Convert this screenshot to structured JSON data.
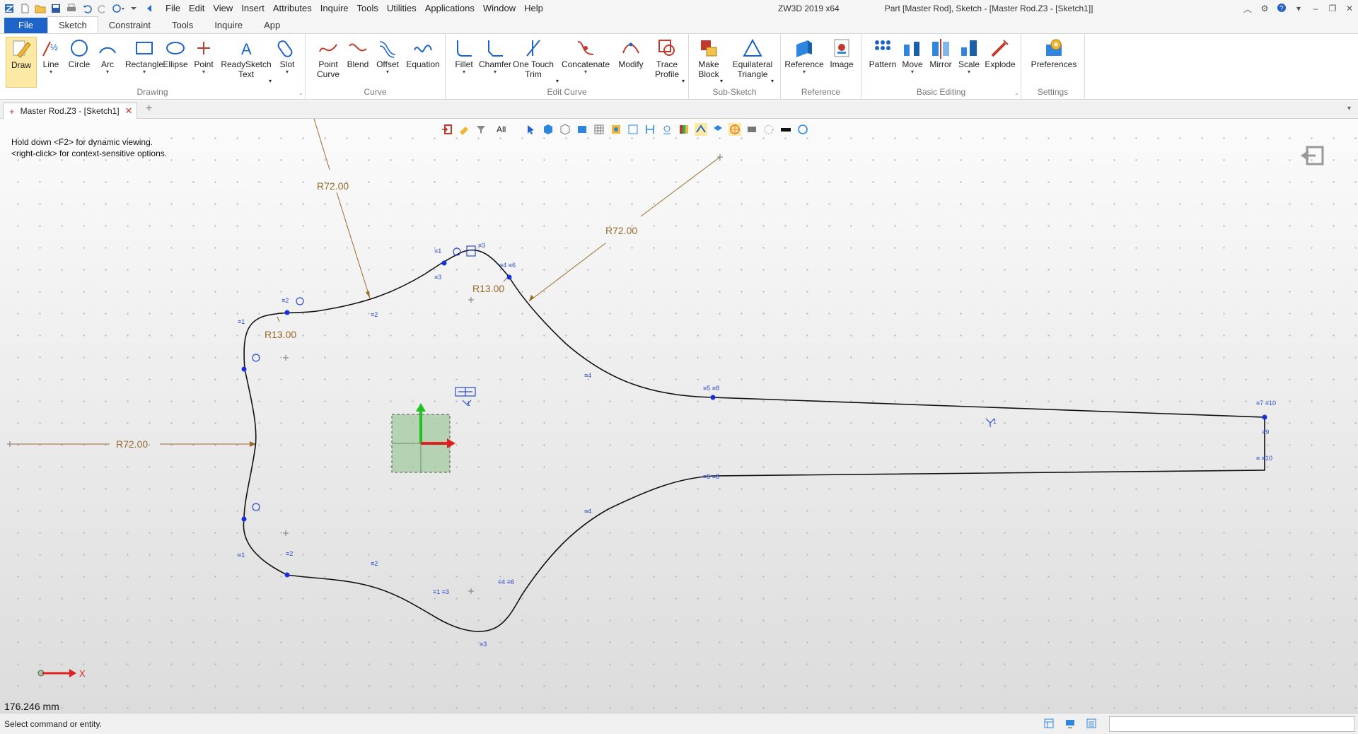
{
  "title": {
    "app": "ZW3D 2019  x64",
    "document": "Part [Master Rod],  Sketch - [Master Rod.Z3 - [Sketch1]]"
  },
  "menu": [
    "File",
    "Edit",
    "View",
    "Insert",
    "Attributes",
    "Inquire",
    "Tools",
    "Utilities",
    "Applications",
    "Window",
    "Help"
  ],
  "tabs": [
    "File",
    "Sketch",
    "Constraint",
    "Tools",
    "Inquire",
    "App"
  ],
  "ribbon": {
    "groups": {
      "drawing": "Drawing",
      "curve": "Curve",
      "edit_curve": "Edit Curve",
      "sub_sketch": "Sub-Sketch",
      "reference": "Reference",
      "basic_editing": "Basic Editing",
      "settings": "Settings"
    },
    "buttons": {
      "draw": "Draw",
      "line": "Line",
      "circle": "Circle",
      "arc": "Arc",
      "rectangle": "Rectangle",
      "ellipse": "Ellipse",
      "point": "Point",
      "readysketch_1": "ReadySketch",
      "readysketch_2": "Text",
      "slot": "Slot",
      "point_curve_1": "Point",
      "point_curve_2": "Curve",
      "blend": "Blend",
      "offset": "Offset",
      "equation": "Equation",
      "fillet": "Fillet",
      "chamfer": "Chamfer",
      "one_touch_1": "One Touch",
      "one_touch_2": "Trim",
      "concatenate": "Concatenate",
      "modify": "Modify",
      "trace_1": "Trace",
      "trace_2": "Profile",
      "make_block_1": "Make",
      "make_block_2": "Block",
      "equilateral_1": "Equilateral",
      "equilateral_2": "Triangle",
      "reference": "Reference",
      "image": "Image",
      "pattern": "Pattern",
      "move": "Move",
      "mirror": "Mirror",
      "scale": "Scale",
      "explode": "Explode",
      "preferences": "Preferences"
    }
  },
  "doc_tab": {
    "label": "Master Rod.Z3 - [Sketch1]"
  },
  "view_toolbar": {
    "filter": "All"
  },
  "canvas": {
    "hint_1": "Hold down <F2> for dynamic viewing.",
    "hint_2": "<right-click> for context-sensitive options.",
    "measurement": "176.246 mm",
    "dimensions": {
      "r72": "R72.00",
      "r13": "R13.00"
    },
    "axis_x": "X"
  },
  "status": {
    "message": "Select command or entity."
  },
  "colors": {
    "accent": "#1e64c8",
    "dimension": "#9a6a2a",
    "constraint": "#2a4bcc",
    "curve": "#111111",
    "point": "#1a2ee0"
  }
}
